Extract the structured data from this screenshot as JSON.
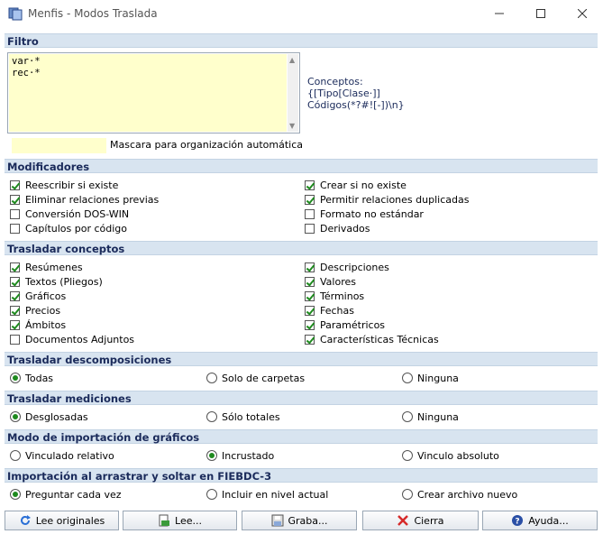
{
  "window": {
    "title": "Menfis - Modos Traslada"
  },
  "filtro": {
    "header": "Filtro",
    "lines": [
      "var·*",
      "rec·*"
    ],
    "concepts_lines": [
      "Conceptos:",
      "{[Tipo[Clase·]]",
      "Códigos(*?#![-])\\n}"
    ],
    "mask_label": "Mascara para organización automática"
  },
  "modificadores": {
    "header": "Modificadores",
    "items": [
      {
        "label": "Reescribir si existe",
        "checked": true
      },
      {
        "label": "Crear si no existe",
        "checked": true
      },
      {
        "label": "Eliminar relaciones previas",
        "checked": true
      },
      {
        "label": "Permitir relaciones duplicadas",
        "checked": true
      },
      {
        "label": "Conversión DOS-WIN",
        "checked": false
      },
      {
        "label": "Formato no estándar",
        "checked": false
      },
      {
        "label": "Capítulos por código",
        "checked": false
      },
      {
        "label": "Derivados",
        "checked": false
      }
    ]
  },
  "trasladar_conceptos": {
    "header": "Trasladar conceptos",
    "items": [
      {
        "label": "Resúmenes",
        "checked": true
      },
      {
        "label": "Descripciones",
        "checked": true
      },
      {
        "label": "Textos (Pliegos)",
        "checked": true
      },
      {
        "label": "Valores",
        "checked": true
      },
      {
        "label": "Gráficos",
        "checked": true
      },
      {
        "label": "Términos",
        "checked": true
      },
      {
        "label": "Precios",
        "checked": true
      },
      {
        "label": "Fechas",
        "checked": true
      },
      {
        "label": "Ámbitos",
        "checked": true
      },
      {
        "label": "Paramétricos",
        "checked": true
      },
      {
        "label": "Documentos Adjuntos",
        "checked": false
      },
      {
        "label": "Características Técnicas",
        "checked": true
      }
    ]
  },
  "descomposiciones": {
    "header": "Trasladar descomposiciones",
    "options": [
      {
        "label": "Todas",
        "selected": true
      },
      {
        "label": "Solo de carpetas",
        "selected": false
      },
      {
        "label": "Ninguna",
        "selected": false
      }
    ]
  },
  "mediciones": {
    "header": "Trasladar mediciones",
    "options": [
      {
        "label": "Desglosadas",
        "selected": true
      },
      {
        "label": "Sólo totales",
        "selected": false
      },
      {
        "label": "Ninguna",
        "selected": false
      }
    ]
  },
  "graficos": {
    "header": "Modo de importación de gráficos",
    "options": [
      {
        "label": "Vinculado relativo",
        "selected": false
      },
      {
        "label": "Incrustado",
        "selected": true
      },
      {
        "label": "Vinculo absoluto",
        "selected": false
      }
    ]
  },
  "arrastrar": {
    "header": "Importación al arrastrar y soltar en FIEBDC-3",
    "options": [
      {
        "label": "Preguntar cada vez",
        "selected": true
      },
      {
        "label": "Incluir en nivel actual",
        "selected": false
      },
      {
        "label": "Crear archivo nuevo",
        "selected": false
      }
    ]
  },
  "buttons": [
    {
      "label": "Lee originales",
      "icon": "refresh-icon",
      "color": "#2a6fd6"
    },
    {
      "label": "Lee...",
      "icon": "open-icon",
      "color": "#3a9a3a"
    },
    {
      "label": "Graba...",
      "icon": "save-icon",
      "color": "#555555"
    },
    {
      "label": "Cierra",
      "icon": "close-icon",
      "color": "#d62a2a"
    },
    {
      "label": "Ayuda...",
      "icon": "help-icon",
      "color": "#2a4fa6"
    }
  ]
}
